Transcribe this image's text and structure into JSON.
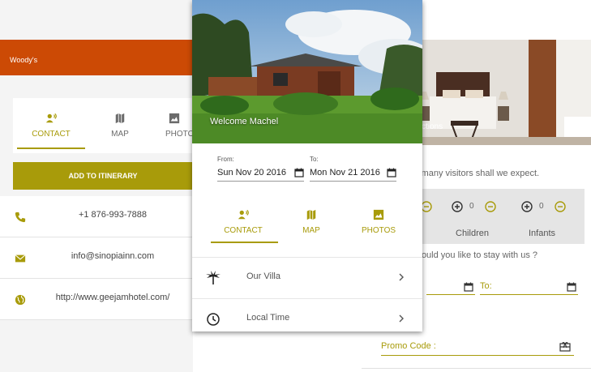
{
  "left": {
    "app_title": "Woody's",
    "tabs": [
      {
        "label": "CONTACT",
        "icon": "contact-phone-icon"
      },
      {
        "label": "MAP",
        "icon": "map-icon"
      },
      {
        "label": "PHOTO",
        "icon": "photos-icon"
      }
    ],
    "active_tab": "CONTACT",
    "add_button": "ADD TO ITINERARY",
    "contacts": [
      {
        "icon": "phone-icon",
        "text": "+1 876-993-7888"
      },
      {
        "icon": "email-icon",
        "text": "info@sinopiainn.com"
      },
      {
        "icon": "globe-icon",
        "text": "http://www.geejamhotel.com/"
      }
    ]
  },
  "middle": {
    "welcome": "Welcome Machel",
    "from_label": "From:",
    "from_value": "Sun Nov 20 2016",
    "to_label": "To:",
    "to_value": "Mon Nov 21 2016",
    "tabs": [
      {
        "label": "CONTACT",
        "icon": "contact-phone-icon"
      },
      {
        "label": "MAP",
        "icon": "map-icon"
      },
      {
        "label": "PHOTOS",
        "icon": "photos-icon"
      }
    ],
    "active_tab": "CONTACT",
    "list": [
      {
        "icon": "palm-tree-icon",
        "label": "Our Villa"
      },
      {
        "icon": "clock-icon",
        "label": "Local Time"
      }
    ]
  },
  "right": {
    "photo_caption": "ctions",
    "visitors_question": "y many visitors shall we expect.",
    "counters": [
      {
        "label": "Children",
        "value": "0"
      },
      {
        "label": "Infants",
        "value": "0"
      }
    ],
    "stay_question": "would you like to stay with us ?",
    "to_label": "To:",
    "promo_label": "Promo Code :"
  },
  "colors": {
    "accent": "#a89b0a",
    "appbar": "#cc4a05",
    "band": "#e5e5e5"
  }
}
